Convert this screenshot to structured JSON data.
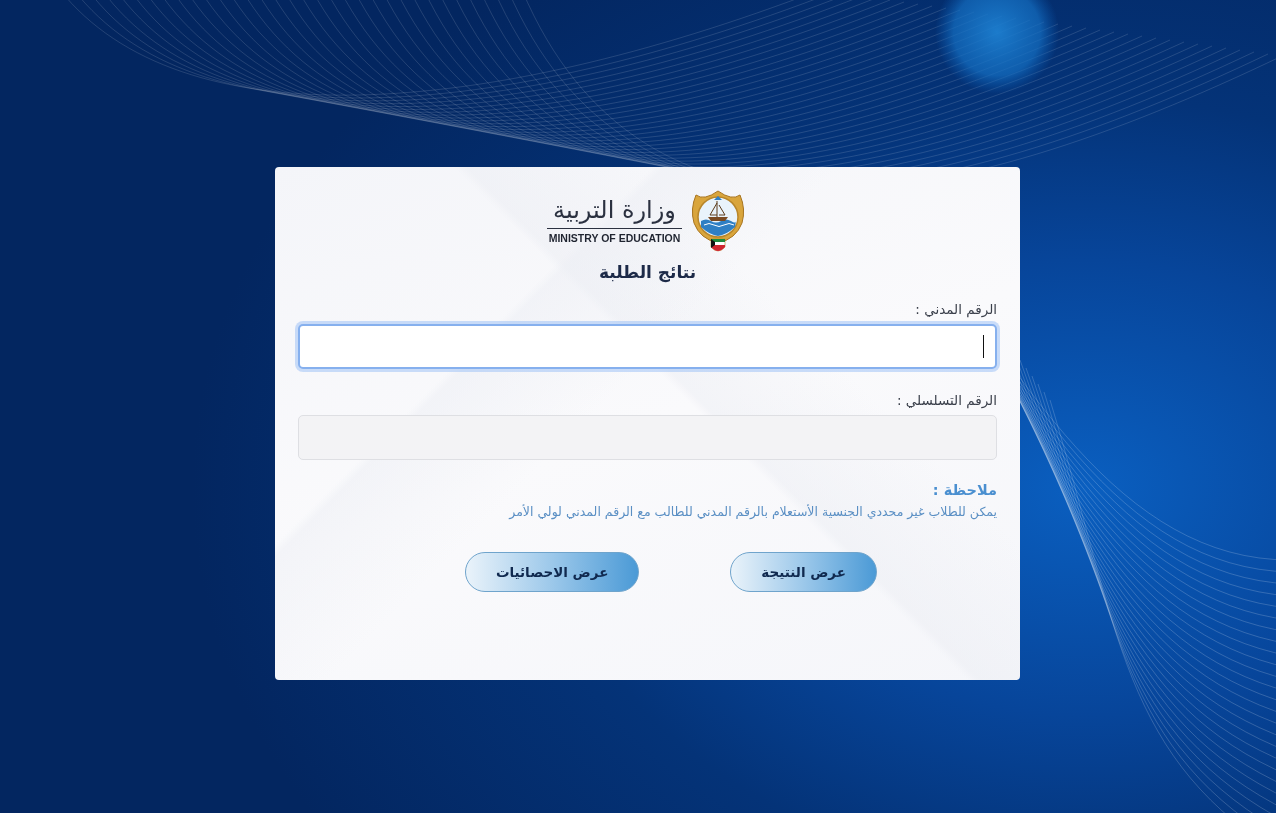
{
  "logo": {
    "arabic_name": "وزارة التربية",
    "english_name": "MINISTRY OF EDUCATION"
  },
  "title": "نتائج الطلبة",
  "fields": [
    {
      "label": "الرقم المدني :",
      "focused": true,
      "disabled": false
    },
    {
      "label": "الرقم التسلسلي :",
      "focused": false,
      "disabled": true
    }
  ],
  "note": {
    "title": "ملاحظة :",
    "text": "يمكن للطلاب غير محددي الجنسية الأستعلام بالرقم المدني للطالب مع الرقم المدني لولي الأمر"
  },
  "buttons": [
    {
      "label": "عرض النتيجة"
    },
    {
      "label": "عرض الاحصائيات"
    }
  ]
}
